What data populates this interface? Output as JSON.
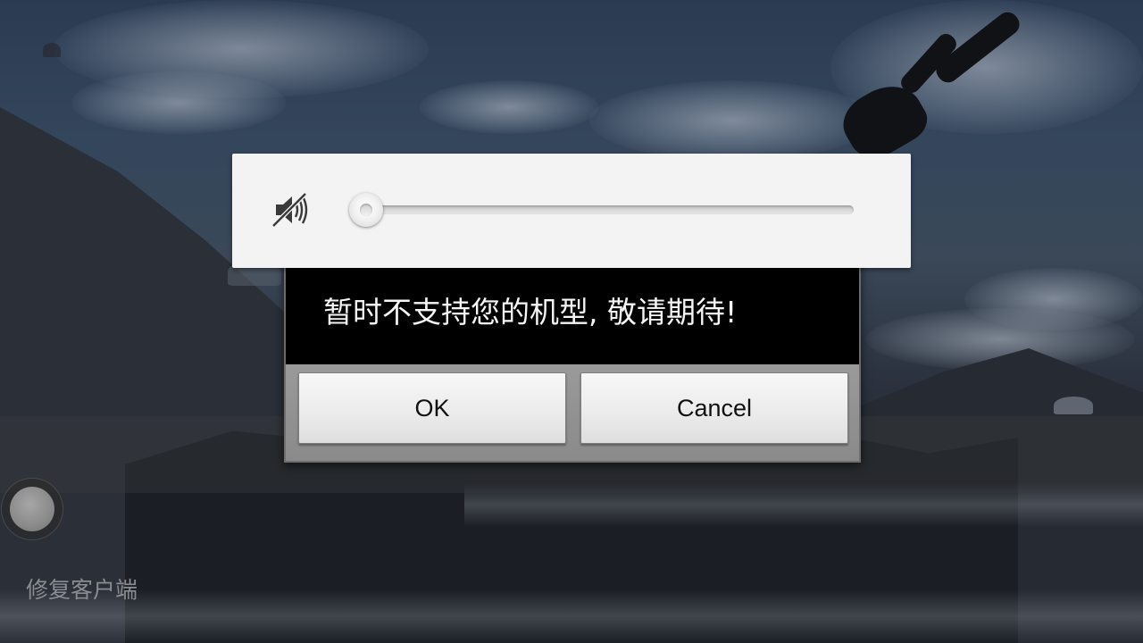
{
  "volume": {
    "icon": "speaker-muted-icon",
    "level_fraction": 0.0
  },
  "dialog": {
    "message": "暂时不支持您的机型, 敬请期待!",
    "ok_label": "OK",
    "cancel_label": "Cancel"
  },
  "game_ui": {
    "repair_client_label": "修复客户端",
    "joystick_icon": "joystick-icon"
  },
  "colors": {
    "dialog_background": "#000000",
    "volume_panel": "#f3f3f3",
    "button_bar": "#8a8a8a"
  }
}
